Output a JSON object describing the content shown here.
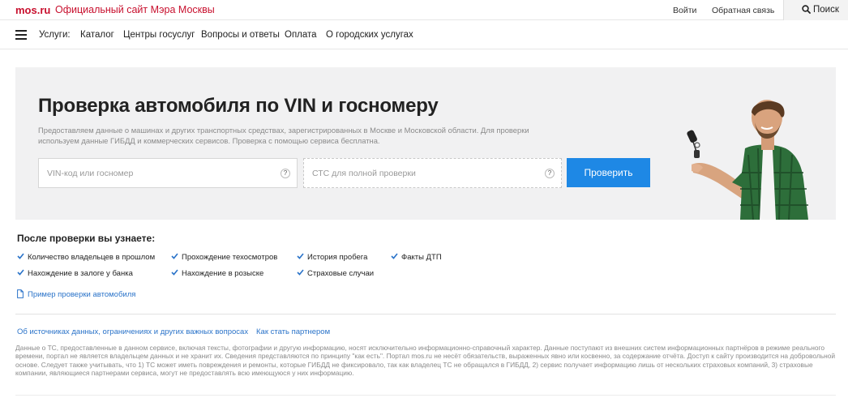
{
  "header": {
    "logo": "mos.ru",
    "site_title": "Официальный сайт Мэра Москвы",
    "login": "Войти",
    "feedback": "Обратная связь",
    "search": "Поиск"
  },
  "nav": {
    "items": [
      "Услуги:",
      "Каталог",
      "Центры госуслуг",
      "Вопросы и ответы",
      "Оплата",
      "О городских услугах"
    ]
  },
  "hero": {
    "title": "Проверка автомобиля по VIN и госномеру",
    "description": "Предоставляем данные о машинах и других транспортных средствах, зарегистрированных в Москве и Московской области. Для проверки используем данные ГИБДД и коммерческих сервисов. Проверка с помощью сервиса бесплатна.",
    "vin_placeholder": "VIN-код или госномер",
    "sts_placeholder": "СТС для полной проверки",
    "help_glyph": "?",
    "submit": "Проверить"
  },
  "results": {
    "title": "После проверки вы узнаете:",
    "features": [
      "Количество владельцев в прошлом",
      "Прохождение техосмотров",
      "История пробега",
      "Факты ДТП",
      "Нахождение в залоге у банка",
      "Нахождение в розыске",
      "Страховые случаи"
    ],
    "example_link": "Пример проверки автомобиля"
  },
  "footer": {
    "links": [
      "Об источниках данных, ограничениях и других важных вопросах",
      "Как стать партнером"
    ],
    "disclaimer": "Данные о ТС, предоставленные в данном сервисе, включая тексты, фотографии и другую информацию, носят исключительно информационно-справочный характер. Данные поступают из внешних систем информационных партнёров в режиме реального времени, портал не является владельцем данных и не хранит их. Сведения представляются по принципу \"как есть\". Портал mos.ru не несёт обязательств, выраженных явно или косвенно, за содержание отчёта. Доступ к сайту производится на добровольной основе. Следует также учитывать, что 1) ТС может иметь повреждения и ремонты, которые ГИБДД не фиксировало, так как владелец ТС не обращался в ГИБДД, 2) сервис получает информацию лишь от нескольких страховых компаний, 3) страховые компании, являющиеся партнерами сервиса, могут не предоставлять всю имеющуюся у них информацию."
  },
  "colors": {
    "brand_red": "#c8102e",
    "accent_blue": "#1e88e5",
    "link_blue": "#2a73c9",
    "hero_bg": "#f1f1f2"
  },
  "icons": {
    "search": "search-icon",
    "menu": "hamburger-menu-icon",
    "help": "question-icon",
    "check": "checkmark-icon",
    "document": "document-icon"
  }
}
